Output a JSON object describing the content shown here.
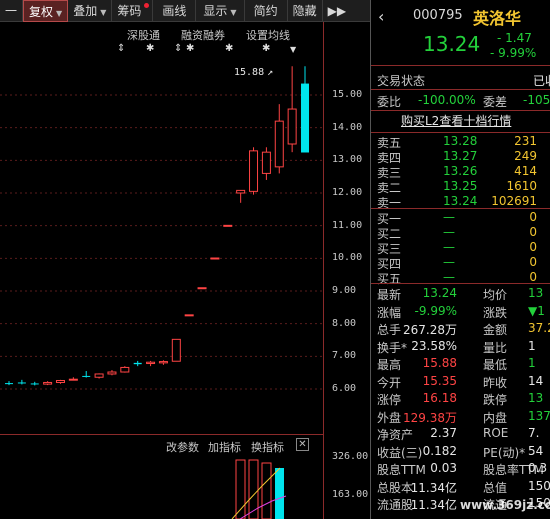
{
  "toolbar": {
    "items": [
      {
        "label": "一"
      },
      {
        "label": "复权"
      },
      {
        "label": "叠加"
      },
      {
        "label": "筹码"
      },
      {
        "label": "画线"
      },
      {
        "label": "显示"
      },
      {
        "label": "简约"
      },
      {
        "label": "隐藏"
      },
      {
        "label": "▶▶"
      }
    ]
  },
  "indicator_bar": {
    "shengutong": "深股通",
    "margin": "融资融券",
    "set_ma": "设置均线"
  },
  "chart": {
    "peak_label": "15.88",
    "price_labels": [
      "15.00",
      "14.00",
      "13.00",
      "12.00",
      "11.00",
      "10.00",
      "9.00",
      "8.00",
      "7.00",
      "6.00"
    ],
    "sub_buttons": {
      "params": "改参数",
      "add": "加指标",
      "switch": "换指标",
      "close": "✕"
    },
    "sub_labels": [
      "326.00",
      "163.00"
    ]
  },
  "chart_data": {
    "type": "candlestick",
    "ylim": [
      5.6,
      15.9
    ],
    "candles": [
      {
        "o": 6.18,
        "h": 6.24,
        "l": 6.12,
        "c": 6.15
      },
      {
        "o": 6.2,
        "h": 6.28,
        "l": 6.14,
        "c": 6.17
      },
      {
        "o": 6.17,
        "h": 6.22,
        "l": 6.11,
        "c": 6.14
      },
      {
        "o": 6.15,
        "h": 6.24,
        "l": 6.12,
        "c": 6.2
      },
      {
        "o": 6.2,
        "h": 6.28,
        "l": 6.16,
        "c": 6.26
      },
      {
        "o": 6.3,
        "h": 6.36,
        "l": 6.26,
        "c": 6.3
      },
      {
        "o": 6.4,
        "h": 6.55,
        "l": 6.35,
        "c": 6.38
      },
      {
        "o": 6.36,
        "h": 6.48,
        "l": 6.32,
        "c": 6.46
      },
      {
        "o": 6.46,
        "h": 6.58,
        "l": 6.42,
        "c": 6.52
      },
      {
        "o": 6.52,
        "h": 6.7,
        "l": 6.5,
        "c": 6.66
      },
      {
        "o": 6.8,
        "h": 6.86,
        "l": 6.7,
        "c": 6.76
      },
      {
        "o": 6.78,
        "h": 6.86,
        "l": 6.7,
        "c": 6.82
      },
      {
        "o": 6.8,
        "h": 6.88,
        "l": 6.74,
        "c": 6.84
      },
      {
        "o": 6.85,
        "h": 7.52,
        "l": 6.85,
        "c": 7.52
      },
      {
        "o": 8.27,
        "h": 8.27,
        "l": 8.27,
        "c": 8.27
      },
      {
        "o": 9.1,
        "h": 9.1,
        "l": 9.1,
        "c": 9.1
      },
      {
        "o": 10.01,
        "h": 10.01,
        "l": 10.01,
        "c": 10.01
      },
      {
        "o": 11.01,
        "h": 11.01,
        "l": 11.01,
        "c": 11.01
      },
      {
        "o": 12.0,
        "h": 12.02,
        "l": 11.7,
        "c": 12.08
      },
      {
        "o": 12.05,
        "h": 13.4,
        "l": 11.95,
        "c": 13.29
      },
      {
        "o": 12.6,
        "h": 13.4,
        "l": 12.4,
        "c": 13.25
      },
      {
        "o": 12.8,
        "h": 14.72,
        "l": 12.6,
        "c": 14.2
      },
      {
        "o": 13.5,
        "h": 15.88,
        "l": 13.25,
        "c": 14.57
      },
      {
        "o": 15.35,
        "h": 15.88,
        "l": 13.24,
        "c": 13.24
      }
    ]
  },
  "stock": {
    "back_icon": "‹",
    "code": "000795",
    "name": "英洛华",
    "price": "13.24",
    "change": "- 1.47",
    "change_pct": "- 9.99%"
  },
  "status": {
    "label": "交易状态",
    "value": "已收",
    "weibi_label": "委比",
    "weibi_value": "-100.00%",
    "weicha_label": "委差",
    "weicha_value": "-105"
  },
  "l2_link": "购买L2查看十档行情",
  "asks": [
    {
      "label": "卖五",
      "price": "13.28",
      "qty": "231"
    },
    {
      "label": "卖四",
      "price": "13.27",
      "qty": "249"
    },
    {
      "label": "卖三",
      "price": "13.26",
      "qty": "414"
    },
    {
      "label": "卖二",
      "price": "13.25",
      "qty": "1610"
    },
    {
      "label": "卖一",
      "price": "13.24",
      "qty": "102691"
    }
  ],
  "bids": [
    {
      "label": "买一",
      "price": "—",
      "qty": "0"
    },
    {
      "label": "买二",
      "price": "—",
      "qty": "0"
    },
    {
      "label": "买三",
      "price": "—",
      "qty": "0"
    },
    {
      "label": "买四",
      "price": "—",
      "qty": "0"
    },
    {
      "label": "买五",
      "price": "—",
      "qty": "0"
    }
  ],
  "stats": [
    {
      "l1": "最新",
      "v1": "13.24",
      "c1": "green",
      "l2": "均价",
      "v2": "13",
      "c2": "green"
    },
    {
      "l1": "涨幅",
      "v1": "-9.99%",
      "c1": "green",
      "l2": "涨跌",
      "v2": "▼1",
      "c2": "green"
    },
    {
      "l1": "总手",
      "v1": "267.28万",
      "c1": "white",
      "l2": "金额",
      "v2": "37.2",
      "c2": "yellow"
    },
    {
      "l1": "换手*",
      "v1": "23.58%",
      "c1": "white",
      "l2": "量比",
      "v2": "1",
      "c2": "white"
    },
    {
      "l1": "最高",
      "v1": "15.88",
      "c1": "red",
      "l2": "最低",
      "v2": "1",
      "c2": "green"
    },
    {
      "l1": "今开",
      "v1": "15.35",
      "c1": "red",
      "l2": "昨收",
      "v2": "14",
      "c2": "white"
    },
    {
      "l1": "涨停",
      "v1": "16.18",
      "c1": "red",
      "l2": "跌停",
      "v2": "13",
      "c2": "green"
    },
    {
      "l1": "外盘",
      "v1": "129.38万",
      "c1": "red",
      "l2": "内盘",
      "v2": "137.8",
      "c2": "green"
    },
    {
      "l1": "净资产",
      "v1": "2.37",
      "c1": "white",
      "l2": "ROE",
      "v2": "7.",
      "c2": "white"
    },
    {
      "l1": "收益(三)",
      "v1": "0.182",
      "c1": "white",
      "l2": "PE(动)*",
      "v2": "54",
      "c2": "white"
    },
    {
      "l1": "股息TTM",
      "v1": "0.03",
      "c1": "white",
      "l2": "股息率TTM",
      "v2": "0.3",
      "c2": "white"
    },
    {
      "l1": "总股本",
      "v1": "11.34亿",
      "c1": "white",
      "l2": "总值",
      "v2": "150.",
      "c2": "white"
    },
    {
      "l1": "流通股",
      "v1": "11.34亿",
      "c1": "white",
      "l2": "流通",
      "v2": "150.",
      "c2": "white"
    }
  ],
  "watermark": "www.369jz.com"
}
